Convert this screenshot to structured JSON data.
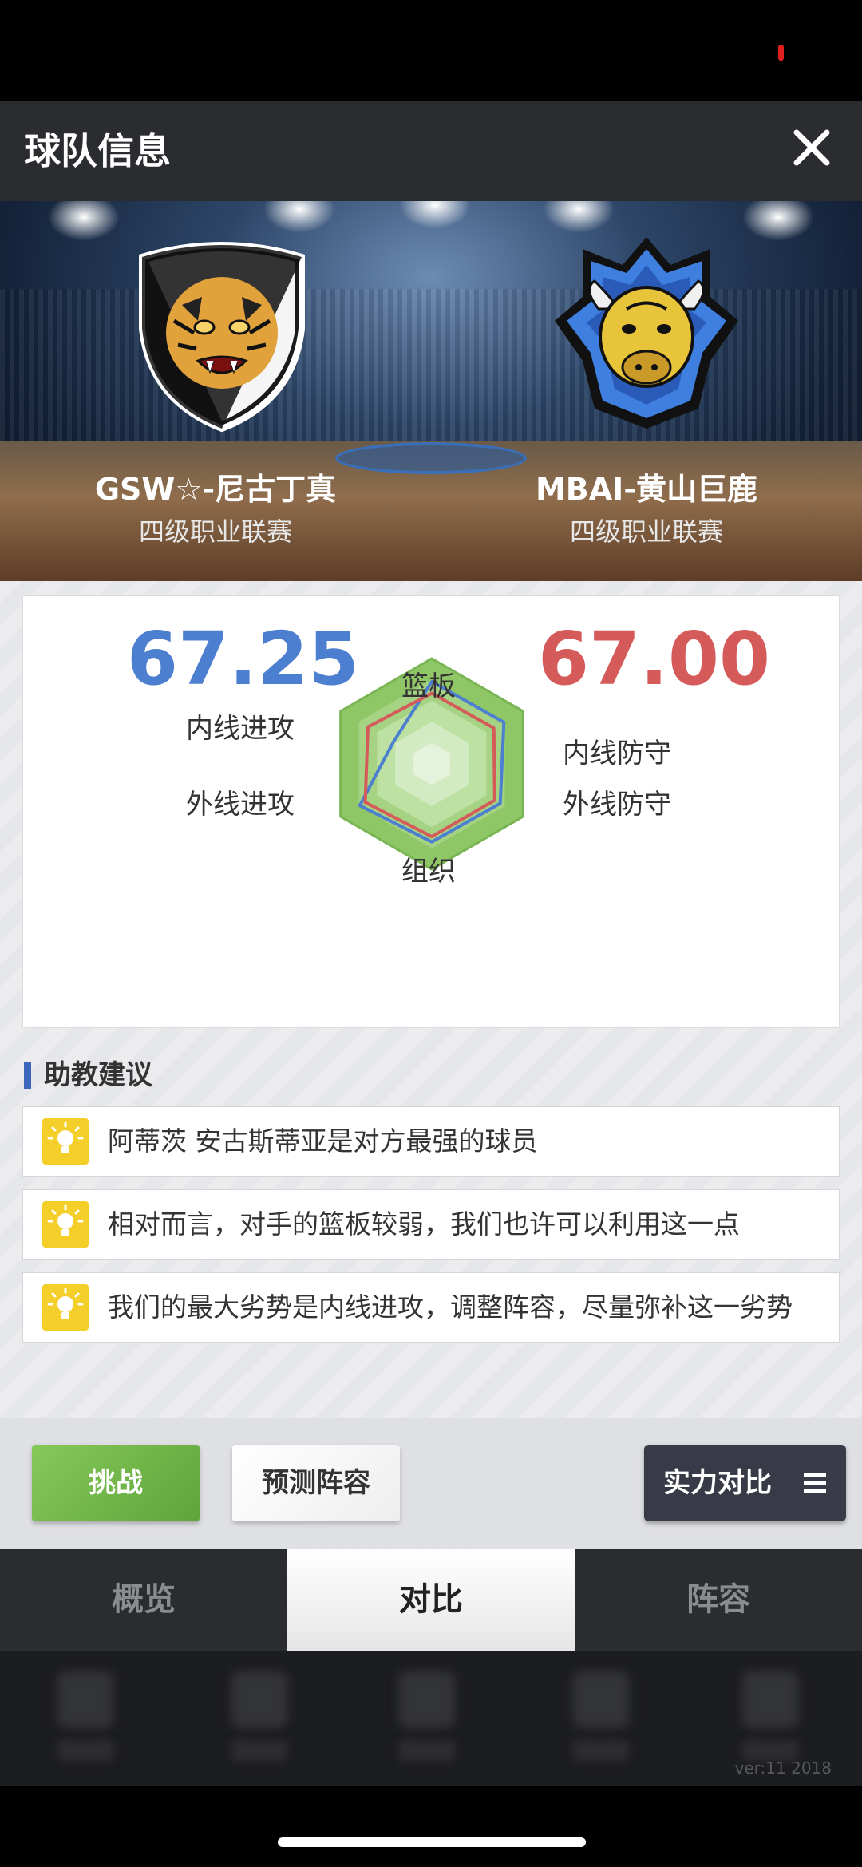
{
  "header": {
    "title": "球队信息",
    "close_icon": "close-icon"
  },
  "teams": {
    "home": {
      "name": "GSW☆-尼古丁真",
      "league": "四级职业联赛",
      "logo": "tiger-crest-logo"
    },
    "away": {
      "name": "MBAI-黄山巨鹿",
      "league": "四级职业联赛",
      "logo": "bison-crest-logo"
    }
  },
  "comparison": {
    "home_score": "67.25",
    "away_score": "67.00",
    "home_color": "#4d7fd0",
    "away_color": "#d55a5a",
    "axes": {
      "rebound": "篮板",
      "inside_defense": "内线防守",
      "outside_defense": "外线防守",
      "playmaking": "组织",
      "outside_offense": "外线进攻",
      "inside_offense": "内线进攻"
    }
  },
  "chart_data": {
    "type": "radar",
    "axes": [
      "篮板",
      "内线防守",
      "外线防守",
      "组织",
      "外线进攻",
      "内线进攻"
    ],
    "rlim": [
      0,
      1
    ],
    "series": [
      {
        "values": [
          0.78,
          0.79,
          0.75,
          0.74,
          0.79,
          0.42
        ]
      },
      {
        "values": [
          0.67,
          0.68,
          0.69,
          0.69,
          0.73,
          0.7
        ]
      }
    ]
  },
  "advice": {
    "title": "助教建议",
    "items": [
      "阿蒂茨 安古斯蒂亚是对方最强的球员",
      "相对而言，对手的篮板较弱，我们也许可以利用这一点",
      "我们的最大劣势是内线进攻，调整阵容，尽量弥补这一劣势"
    ],
    "icon": "lightbulb-icon"
  },
  "actions": {
    "challenge": "挑战",
    "predict_lineup": "预测阵容",
    "strength_compare": "实力对比"
  },
  "tabs": [
    "概览",
    "对比",
    "阵容"
  ],
  "active_tab": "对比",
  "version": "ver:11  2018"
}
